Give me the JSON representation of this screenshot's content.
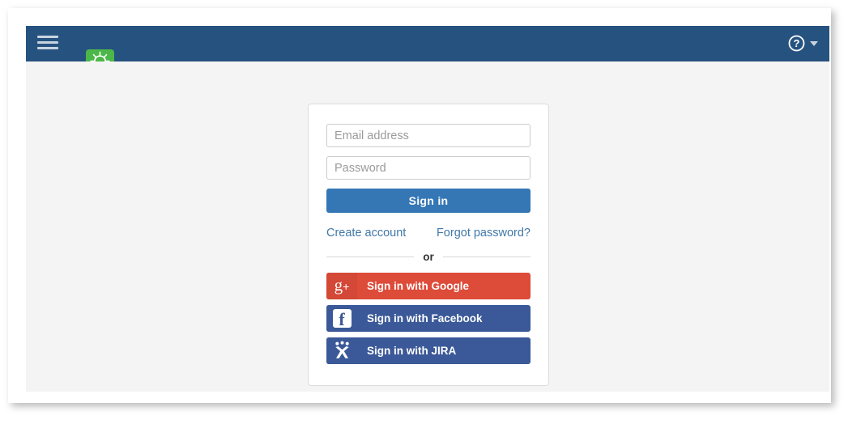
{
  "header": {
    "menu_icon": "hamburger-icon",
    "logo_icon": "lightbulb-icon",
    "help_icon": "question-mark-circle-icon",
    "help_caret_icon": "caret-down-icon",
    "bar_color": "#26527f",
    "logo_color": "#4cb749"
  },
  "login": {
    "email_placeholder": "Email address",
    "email_value": "",
    "password_placeholder": "Password",
    "password_value": "",
    "signin_label": "Sign in",
    "signin_color": "#3577b5",
    "create_account_label": "Create account",
    "forgot_password_label": "Forgot password?",
    "divider_label": "or",
    "link_color": "#4078a8"
  },
  "social": [
    {
      "label": "Sign in with Google",
      "icon": "google-plus-icon",
      "glyph": "g",
      "plus": "+",
      "color": "#dd4b39"
    },
    {
      "label": "Sign in with Facebook",
      "icon": "facebook-icon",
      "glyph": "f",
      "color": "#3b5998"
    },
    {
      "label": "Sign in with JIRA",
      "icon": "jira-person-icon",
      "color": "#3b5998"
    }
  ]
}
